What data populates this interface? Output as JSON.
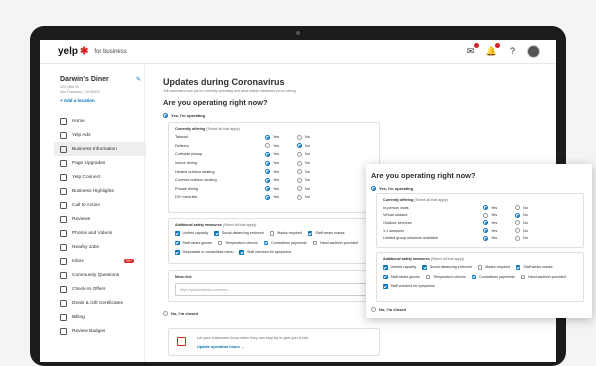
{
  "header": {
    "logo": "yelp",
    "logo_suffix": "for business",
    "icons": [
      "messages-icon",
      "notifications-icon",
      "help-icon",
      "avatar"
    ]
  },
  "sidebar": {
    "business_name": "Darwin's Diner",
    "address_line1": "123 Little St.",
    "address_line2": "San Francisco, CA 00070",
    "add_location": "+ Add a location",
    "items": [
      {
        "label": "Home",
        "icon": "home-icon"
      },
      {
        "label": "Yelp Ads",
        "icon": "megaphone-icon"
      },
      {
        "label": "Business Information",
        "icon": "store-icon"
      },
      {
        "label": "Page Upgrades",
        "icon": "upgrade-icon"
      },
      {
        "label": "Yelp Connect",
        "icon": "connect-icon"
      },
      {
        "label": "Business Highlights",
        "icon": "highlight-icon"
      },
      {
        "label": "Call to Action",
        "icon": "cta-icon"
      },
      {
        "label": "Reviews",
        "icon": "reviews-icon"
      },
      {
        "label": "Photos and Videos",
        "icon": "photo-icon"
      },
      {
        "label": "Nearby Jobs",
        "icon": "jobs-icon"
      },
      {
        "label": "Inbox",
        "icon": "inbox-icon",
        "badge": "99+"
      },
      {
        "label": "Community Questions",
        "icon": "community-icon"
      },
      {
        "label": "Check-In Offers",
        "icon": "checkin-icon"
      },
      {
        "label": "Deals & Gift Certificates",
        "icon": "deals-icon"
      },
      {
        "label": "Billing",
        "icon": "billing-icon"
      },
      {
        "label": "Review Badges",
        "icon": "badge-icon"
      }
    ],
    "active_index": 2
  },
  "main": {
    "title": "Updates during Coronavirus",
    "subtitle": "Tell customers how you're currently operating and what safety measures you're taking.",
    "question": "Are you operating right now?",
    "yes_label": "Yes, I'm operating",
    "no_label": "No, I'm closed",
    "offering_heading": "Currently offering",
    "offering_hint": "(Select all that apply)",
    "yes_text": "Yes",
    "no_text": "No",
    "offerings": [
      {
        "label": "Takeout",
        "value": "yes"
      },
      {
        "label": "Delivery",
        "value": "no"
      },
      {
        "label": "Curbside pickup",
        "value": "yes"
      },
      {
        "label": "Indoor dining",
        "value": "yes"
      },
      {
        "label": "Heated outdoor seating",
        "value": "yes"
      },
      {
        "label": "Covered outdoor seating",
        "value": "yes"
      },
      {
        "label": "Private dining",
        "value": "yes"
      },
      {
        "label": "DIY meal kits",
        "value": "yes"
      }
    ],
    "safety_heading": "Additional safety measures",
    "safety_hint": "(Select all that apply)",
    "safety_measures": [
      {
        "label": "Limited capacity",
        "checked": true
      },
      {
        "label": "Social distancing enforced",
        "checked": true
      },
      {
        "label": "Masks required",
        "checked": false
      },
      {
        "label": "Staff wears masks",
        "checked": true
      },
      {
        "label": "Staff wears gloves",
        "checked": true
      },
      {
        "label": "Temperature checks",
        "checked": false
      },
      {
        "label": "Contactless payments",
        "checked": true
      },
      {
        "label": "Hand sanitizer provided",
        "checked": false
      },
      {
        "label": "Disposable or contactless menu",
        "checked": true
      },
      {
        "label": "Staff checked for symptoms",
        "checked": true
      }
    ],
    "menu_link_label": "Menu link",
    "menu_link_placeholder": "https://yourbusiness.com/menu",
    "notice_text": "Let your customers know when they can stop by or give you a call.",
    "notice_link": "Update operation hours →"
  },
  "zoom_panel": {
    "question": "Are you operating right now?",
    "yes_label": "Yes, I'm operating",
    "no_label": "No, I'm closed",
    "offering_heading": "Currently offering",
    "offering_hint": "(Select all that apply)",
    "offerings": [
      {
        "label": "In-person visits",
        "value": "yes"
      },
      {
        "label": "Virtual classes",
        "value": "no"
      },
      {
        "label": "Outdoor services",
        "value": "yes"
      },
      {
        "label": "1:1 sessions",
        "value": "yes"
      },
      {
        "label": "Limited group sessions available",
        "value": "yes"
      }
    ],
    "safety_heading": "Additional safety measures",
    "safety_hint": "(Select all that apply)",
    "safety_measures": [
      {
        "label": "Limited capacity",
        "checked": true
      },
      {
        "label": "Social distancing enforced",
        "checked": true
      },
      {
        "label": "Masks required",
        "checked": false
      },
      {
        "label": "Staff wears masks",
        "checked": true
      },
      {
        "label": "Staff wears gloves",
        "checked": true
      },
      {
        "label": "Temperature checks",
        "checked": false
      },
      {
        "label": "Contactless payments",
        "checked": true
      },
      {
        "label": "Hand sanitizer provided",
        "checked": false
      },
      {
        "label": "Staff checked for symptoms",
        "checked": true
      }
    ]
  },
  "colors": {
    "brand": "#d32323",
    "accent": "#0073bb",
    "device": "#1c1c1c"
  }
}
